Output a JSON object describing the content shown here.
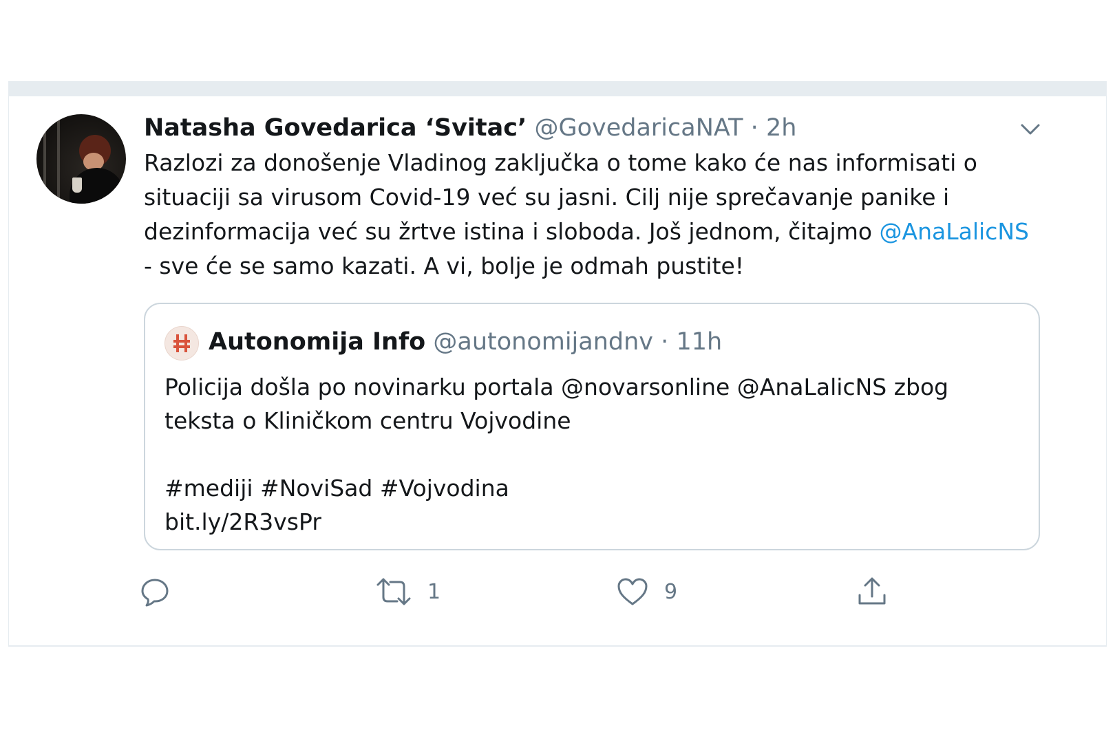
{
  "tweet": {
    "author": {
      "display_name": "Natasha Govedarica ‘Svitac’",
      "handle": "@GovedaricaNAT",
      "separator": "·",
      "time": "2h"
    },
    "text_before_mention": "Razlozi za donošenje Vladinog zaključka o tome kako će nas informisati o situaciji sa virusom Covid-19 već su jasni. Cilj nije sprečavanje panike i dezinformacija već su žrtve istina i sloboda. Još jednom, čitajmo ",
    "mention": "@AnaLalicNS",
    "text_after_mention": " - sve će se samo kazati. A vi, bolje je odmah pustite!",
    "quoted": {
      "display_name": "Autonomija Info",
      "handle": "@autonomijandnv",
      "separator": "·",
      "time": "11h",
      "line1": "Policija došla po novinarku portala @novarsonline @AnaLalicNS zbog teksta o Kliničkom centru Vojvodine",
      "hashtags": "#mediji #NoviSad #Vojvodina",
      "link": "bit.ly/2R3vsPr"
    },
    "actions": {
      "reply_icon": "reply-icon",
      "retweet_icon": "retweet-icon",
      "retweet_count": "1",
      "like_icon": "heart-icon",
      "like_count": "9",
      "share_icon": "share-icon"
    },
    "colors": {
      "mention": "#1b95e0",
      "secondary_text": "#657786",
      "icon": "#657786",
      "border": "#ccd6dd"
    }
  }
}
